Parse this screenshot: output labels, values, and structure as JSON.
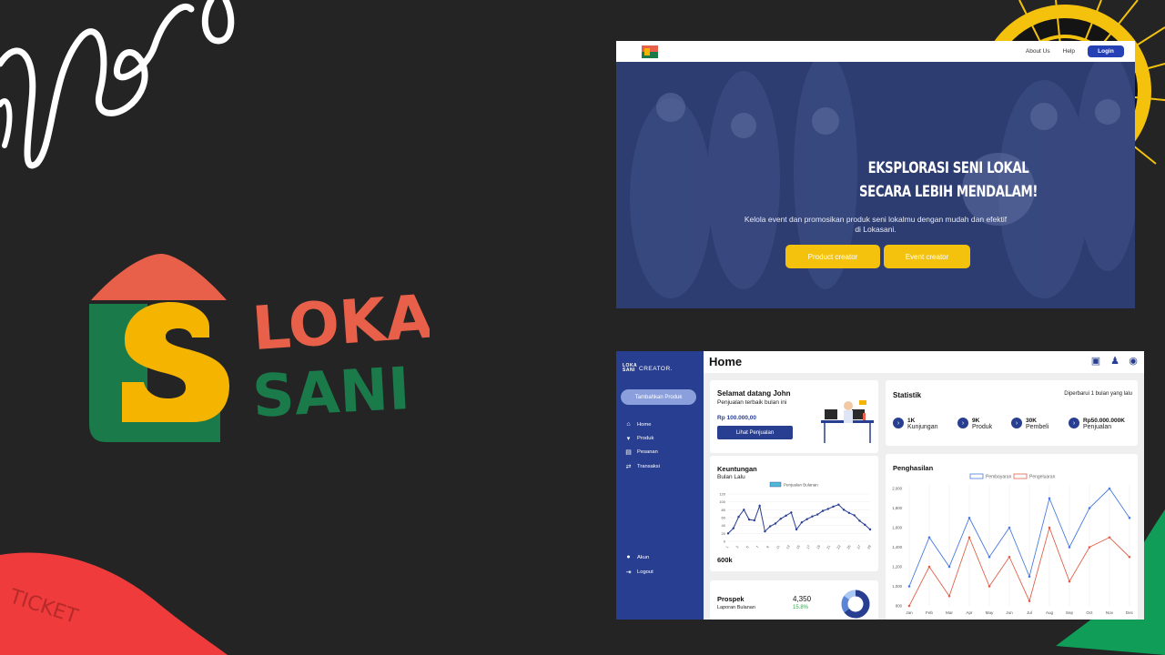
{
  "brand": {
    "logo_text_top": "LOKA",
    "logo_text_bottom": "SANI",
    "colors": {
      "orange": "#e8604a",
      "yellow": "#f4b400",
      "green": "#1a7a4a",
      "navy": "#283f91"
    }
  },
  "decor": {
    "ticket_text": "TICKET"
  },
  "landing": {
    "nav": {
      "about": "About Us",
      "help": "Help",
      "login": "Login"
    },
    "hero": {
      "title_line1": "EKSPLORASI SENI LOKAL",
      "title_line2": "SECARA LEBIH MENDALAM!",
      "subtitle": "Kelola event dan promosikan produk seni lokalmu dengan mudah dan efektif di Lokasani.",
      "btn_product": "Product creator",
      "btn_event": "Event creator"
    }
  },
  "dashboard": {
    "brand_mark": "LOKA SANI",
    "brand_suffix": "CREATOR.",
    "add_button": "Tambahkan Produk",
    "menu": [
      {
        "icon": "home-icon",
        "label": "Home"
      },
      {
        "icon": "cart-icon",
        "label": "Produk"
      },
      {
        "icon": "orders-icon",
        "label": "Pesanan"
      },
      {
        "icon": "transfer-icon",
        "label": "Transaksi"
      }
    ],
    "bottom_menu": [
      {
        "icon": "user-icon",
        "label": "Akun"
      },
      {
        "icon": "logout-icon",
        "label": "Logout"
      }
    ],
    "header_title": "Home",
    "welcome": {
      "title": "Selamat datang John",
      "subtitle": "Penjualan terbaik bulan ini",
      "amount": "Rp 100.000,00",
      "button": "Lihat Penjualan"
    },
    "statistik": {
      "title": "Statistik",
      "updated": "Diperbarui 1 bulan yang lalu",
      "items": [
        {
          "value": "1K",
          "label": "Kunjungan"
        },
        {
          "value": "9K",
          "label": "Produk"
        },
        {
          "value": "30K",
          "label": "Pembeli"
        },
        {
          "value": "Rp50.000.000K",
          "label": "Penjualan"
        }
      ]
    },
    "keuntungan": {
      "title": "Keuntungan",
      "subtitle": "Bulan Lalu",
      "total": "600k"
    },
    "penghasilan": {
      "title": "Penghasilan"
    },
    "prospek": {
      "title": "Prospek",
      "subtitle": "Laporan Bulanan",
      "value": "4,350",
      "change": "15.8%"
    }
  },
  "chart_data": [
    {
      "type": "line",
      "title": "Keuntungan",
      "series": [
        {
          "name": "Penjualan Bulanan",
          "values": [
            20,
            33,
            62,
            80,
            55,
            53,
            90,
            25,
            38,
            45,
            57,
            65,
            73,
            30,
            48,
            56,
            63,
            68,
            77,
            82,
            88,
            93,
            80,
            72,
            66,
            52,
            42,
            30
          ]
        }
      ],
      "x": [
        1,
        2,
        3,
        4,
        5,
        6,
        7,
        8,
        9,
        10,
        11,
        12,
        13,
        14,
        15,
        16,
        17,
        18,
        19,
        20,
        21,
        22,
        23,
        24,
        25,
        26,
        27,
        28
      ],
      "ylim": [
        0,
        120
      ],
      "yticks": [
        0,
        20,
        40,
        60,
        80,
        100,
        120
      ],
      "xticks": [
        "1",
        "3",
        "5",
        "7",
        "9",
        "11",
        "13",
        "15",
        "17",
        "19",
        "21",
        "23",
        "25",
        "27",
        "29"
      ],
      "legend": "top-center",
      "color": "#283f91"
    },
    {
      "type": "line",
      "title": "Penghasilan",
      "categories": [
        "Jan",
        "Feb",
        "Mar",
        "Apr",
        "May",
        "Jun",
        "Jul",
        "Aug",
        "Sep",
        "Oct",
        "Nov",
        "Dec"
      ],
      "series": [
        {
          "name": "Pembayaran",
          "color": "#4a7be0",
          "values": [
            1000,
            1500,
            1200,
            1700,
            1300,
            1600,
            1100,
            1900,
            1400,
            1800,
            2000,
            1700
          ]
        },
        {
          "name": "Pengeluaran",
          "color": "#e0614a",
          "values": [
            800,
            1200,
            900,
            1500,
            1000,
            1300,
            850,
            1600,
            1050,
            1400,
            1500,
            1300
          ]
        }
      ],
      "ylim": [
        800,
        2000
      ],
      "yticks": [
        "800",
        "1,000",
        "1,200",
        "1,400",
        "1,600",
        "1,800",
        "2,000"
      ],
      "legend": "top-center"
    },
    {
      "type": "pie",
      "title": "Prospek",
      "values": [
        65,
        20,
        15
      ],
      "colors": [
        "#283f91",
        "#5b86d8",
        "#aac6f2"
      ]
    }
  ]
}
